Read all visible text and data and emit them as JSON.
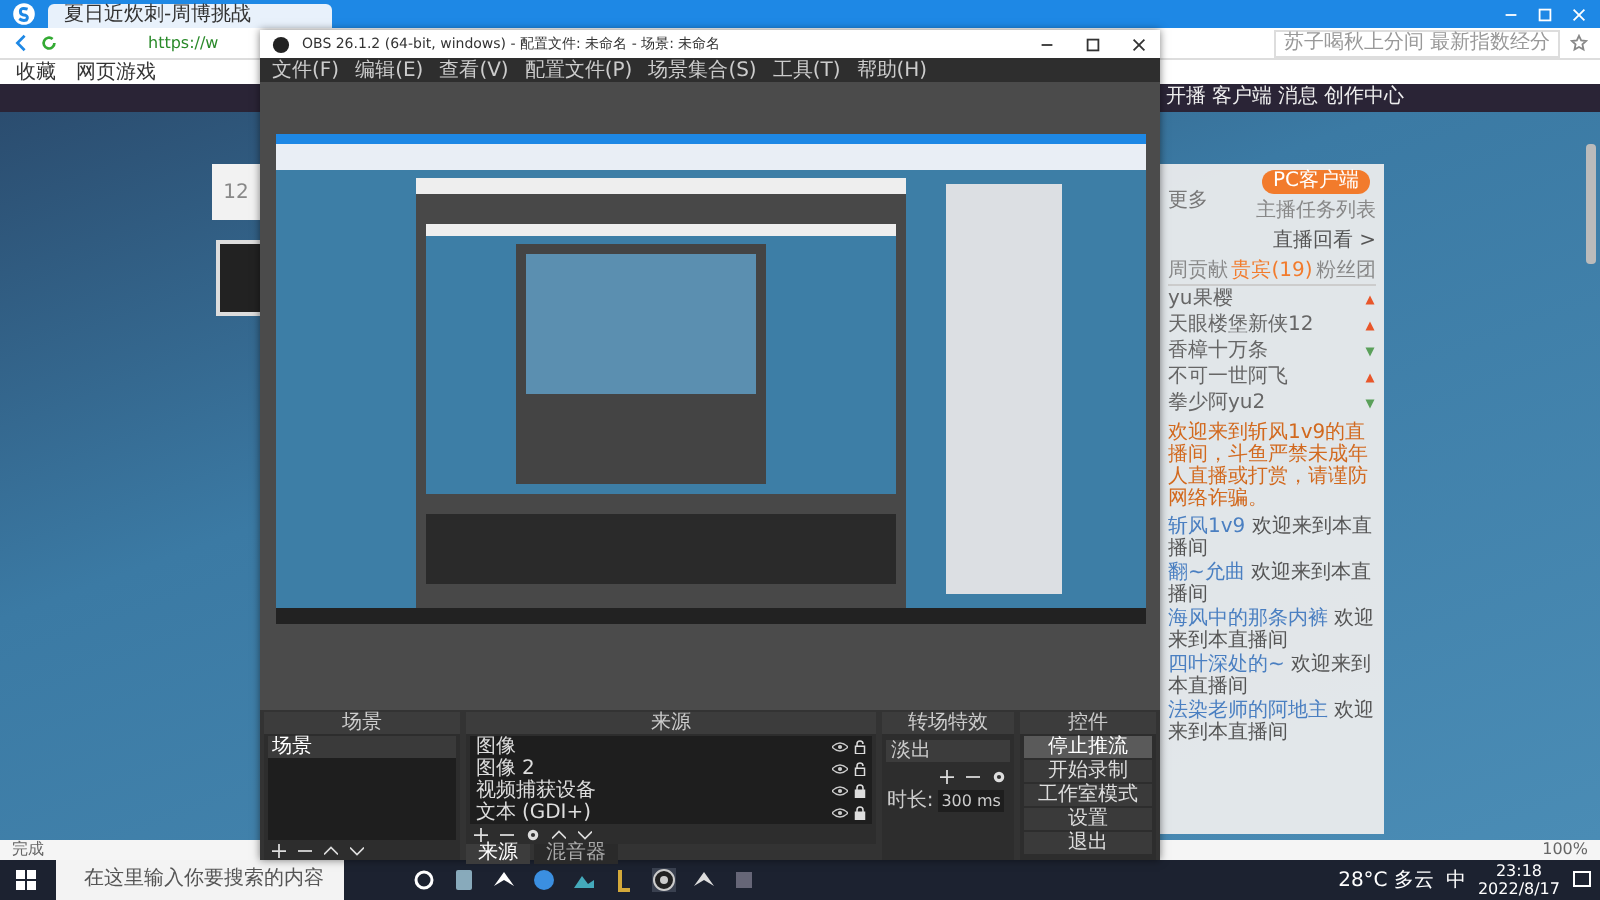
{
  "browser": {
    "tab_title": "夏日近炊刺-周博挑战",
    "url": "https://w",
    "search_hint": "苏子喝秋上分间 最新指数经分",
    "bookmarks": [
      "收藏",
      "网页游戏"
    ],
    "status": "完成",
    "zoom": "100%"
  },
  "site": {
    "nav": [
      "开播",
      "客户端",
      "消息",
      "创作中心"
    ],
    "left_card_count": "12",
    "more_label": "更多",
    "client_button": "PC客户端",
    "client_note": "主播任务列表",
    "links": [
      "直播回看 >"
    ],
    "tabs": [
      {
        "label": "周贡献",
        "selected": false
      },
      {
        "label": "贵宾(19)",
        "selected": true
      },
      {
        "label": "粉丝团",
        "selected": false
      }
    ],
    "ranks": [
      {
        "name": "yu果樱",
        "up": true
      },
      {
        "name": "天眼楼堡新侠12",
        "up": true
      },
      {
        "name": "香樟十万条",
        "up": false
      },
      {
        "name": "不可一世阿飞",
        "up": true
      },
      {
        "name": "拳少阿yu2",
        "up": false
      }
    ],
    "notice": "欢迎来到斩风1v9的直播间，斗鱼严禁未成年人直播或打赏，请谨防网络诈骗。",
    "chat": [
      {
        "user": "斩风1v9",
        "text": "欢迎来到本直播间"
      },
      {
        "user": "翻~允曲",
        "text": "欢迎来到本直播间"
      },
      {
        "user": "海风中的那条内裤",
        "text": "欢迎来到本直播间"
      },
      {
        "user": "四叶深处的~",
        "text": "欢迎来到本直播间"
      },
      {
        "user": "法染老师的阿地主",
        "text": "欢迎来到本直播间"
      }
    ]
  },
  "obs": {
    "title": "OBS 26.1.2 (64-bit, windows) - 配置文件: 未命名 - 场景: 未命名",
    "menu": [
      "文件(F)",
      "编辑(E)",
      "查看(V)",
      "配置文件(P)",
      "场景集合(S)",
      "工具(T)",
      "帮助(H)"
    ],
    "scenes": {
      "title": "场景",
      "items": [
        {
          "label": "场景",
          "selected": true
        }
      ]
    },
    "sources": {
      "title": "来源",
      "items": [
        {
          "label": "图像",
          "locked": false
        },
        {
          "label": "图像 2",
          "locked": false
        },
        {
          "label": "视频捕获设备",
          "locked": true
        },
        {
          "label": "文本 (GDI+)",
          "locked": true
        }
      ]
    },
    "transitions": {
      "title": "转场特效",
      "type": "淡出",
      "duration_label": "时长:",
      "duration": "300 ms"
    },
    "controls": {
      "title": "控件",
      "buttons": [
        {
          "label": "停止推流",
          "active": true
        },
        {
          "label": "开始录制",
          "active": false
        },
        {
          "label": "工作室模式",
          "active": false
        },
        {
          "label": "设置",
          "active": false
        },
        {
          "label": "退出",
          "active": false
        }
      ]
    },
    "bottom_tabs": [
      {
        "label": "来源",
        "selected": true
      },
      {
        "label": "混音器",
        "selected": false
      }
    ]
  },
  "taskbar": {
    "search_placeholder": "在这里输入你要搜索的内容",
    "weather": "28°C 多云",
    "ime": "中",
    "time": "23:18",
    "date": "2022/8/17"
  }
}
